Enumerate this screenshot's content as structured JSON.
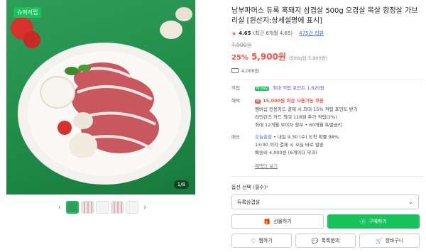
{
  "image": {
    "badge": "슈퍼적립",
    "counter": "1/8"
  },
  "product": {
    "title": "남부파머스 듀록 흑돼지 삼겹살 500g 오겹살 목살 항정살 가브리살 [원산지:상세설명에 표시]",
    "rating_score": "4.65",
    "rating_detail": "(최근 6개월 4.65)",
    "review_count": "475건 리뷰",
    "original_price": "7,900원",
    "discount": "25%",
    "price": "5,900원",
    "unit_price": "(500g당 5,900원)",
    "delivery_fee": "4,000원"
  },
  "benefits": {
    "points_label": "적립",
    "npay_tag": "N pay",
    "points_text": "최대 적립 포인트 1,625원",
    "benefit_label": "혜택",
    "coupon_tag": "N",
    "coupon_text": "15,000원 이상 사용가능 쿠폰",
    "membership_line": "멤버십 전용카드 결제 시 최대 15% 적립 포인트 받기",
    "card_line": "라인런즈 카드 최대 118원 추가 적립(2%)",
    "installment_line": "최대 12개월 무이자 할부 • 60개월 특별금리",
    "delivery_label": "배송",
    "today_ship": "오늘출발",
    "ship_line1": "• 내일 9.30 (수) 도착 확률 98%",
    "ship_line2": "13:00 까지 결제 시 오늘 바로 발송",
    "ship_line3": "배송비 4,000원 (6개이다 부과)",
    "more_link": "혜택더 보기"
  },
  "options": {
    "label": "옵션 선택 (필수)",
    "required_mark": "*",
    "selected": "듀록삼겹살"
  },
  "buttons": {
    "gift": "선물하기",
    "buy": "구매하기",
    "wish": "찜하기",
    "talk": "톡톡문의",
    "cart": "장바구니"
  },
  "colors": {
    "accent": "#19c35c",
    "price": "#f15746"
  }
}
